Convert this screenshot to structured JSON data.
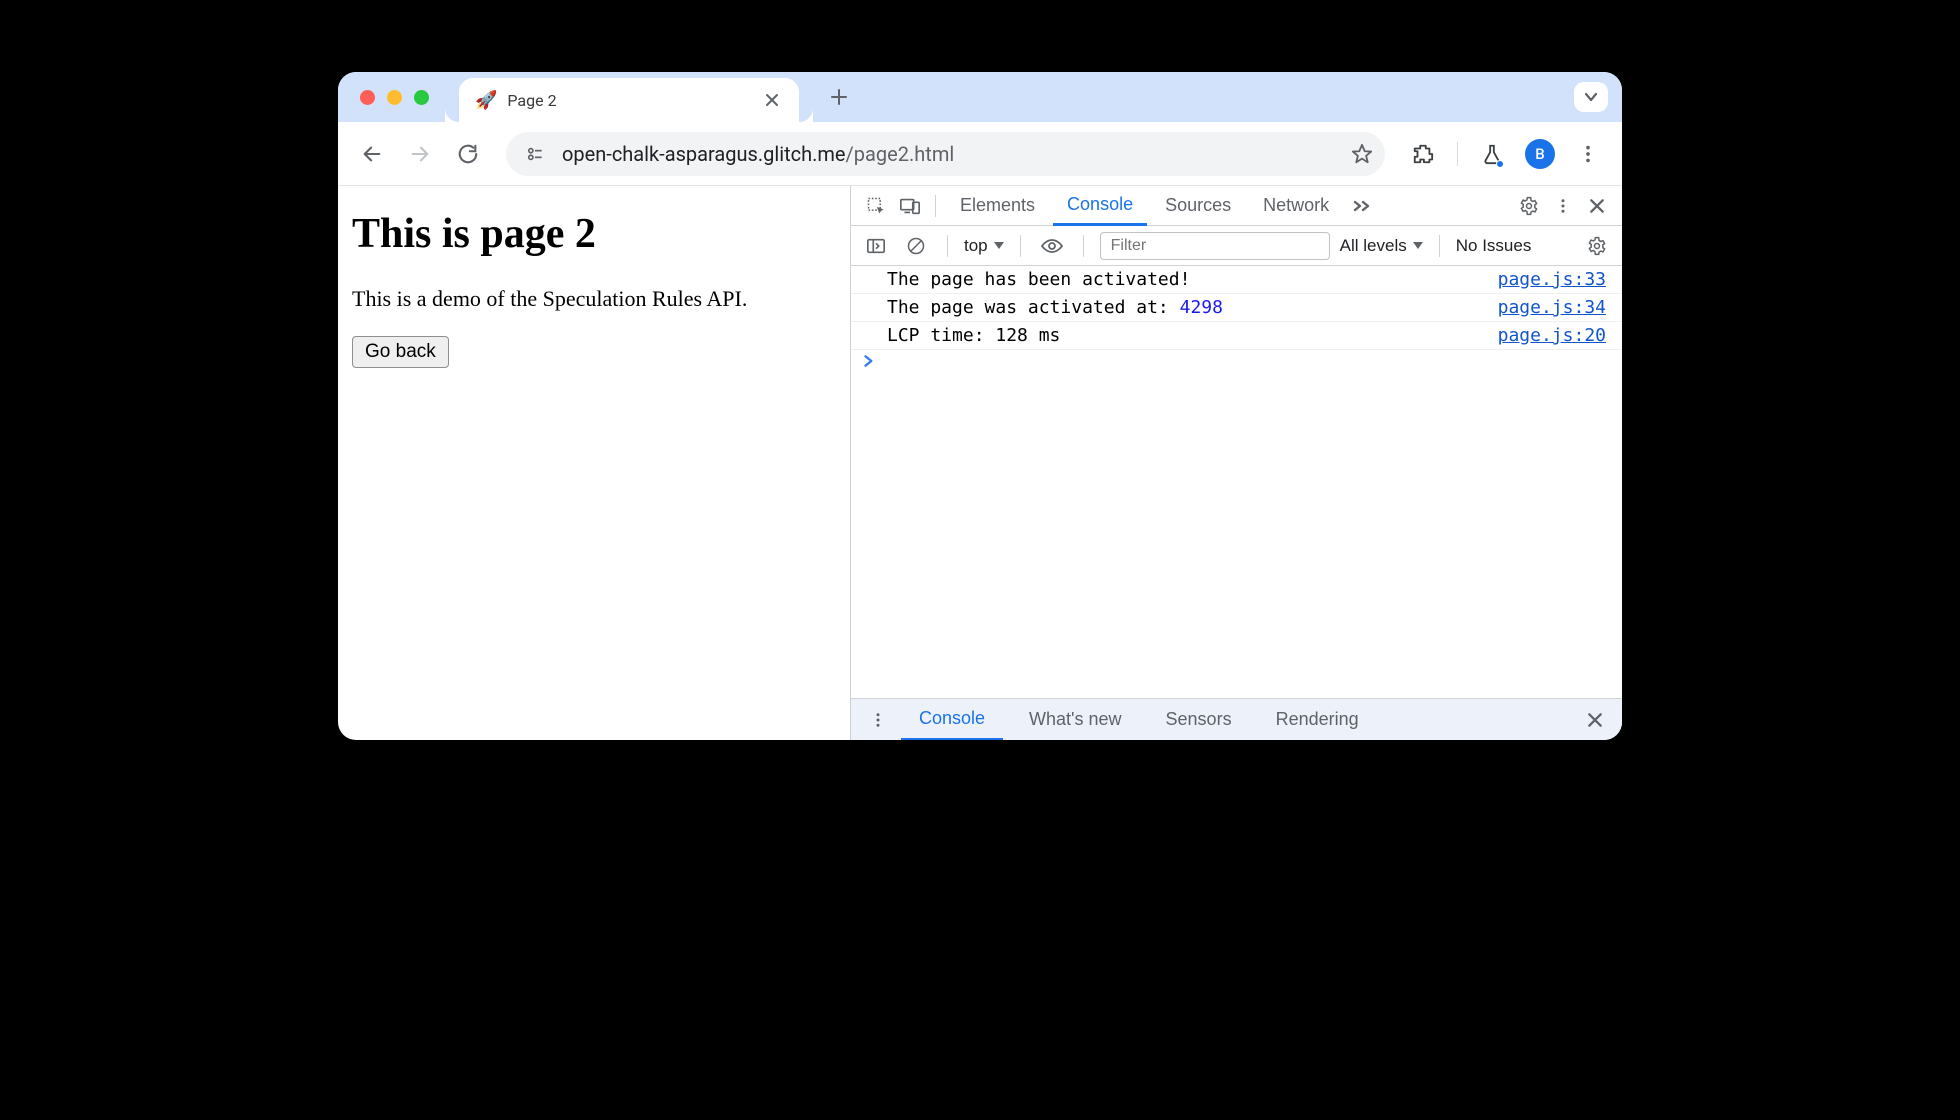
{
  "tab": {
    "favicon": "🚀",
    "title": "Page 2"
  },
  "addressbar": {
    "host": "open-chalk-asparagus.glitch.me",
    "path": "/page2.html"
  },
  "avatar_letter": "B",
  "page": {
    "heading": "This is page 2",
    "paragraph": "This is a demo of the Speculation Rules API.",
    "back_button": "Go back"
  },
  "devtools": {
    "tabs": {
      "elements": "Elements",
      "console": "Console",
      "sources": "Sources",
      "network": "Network"
    },
    "console_toolbar": {
      "context": "top",
      "filter_placeholder": "Filter",
      "levels": "All levels",
      "issues": "No Issues"
    },
    "logs": [
      {
        "msg_pre": "The page has been activated!",
        "msg_num": "",
        "msg_post": "",
        "src": "page.js:33"
      },
      {
        "msg_pre": "The page was activated at: ",
        "msg_num": "4298",
        "msg_post": "",
        "src": "page.js:34"
      },
      {
        "msg_pre": "LCP time: 128 ms",
        "msg_num": "",
        "msg_post": "",
        "src": "page.js:20"
      }
    ],
    "drawer": {
      "console": "Console",
      "whatsnew": "What's new",
      "sensors": "Sensors",
      "rendering": "Rendering"
    }
  }
}
